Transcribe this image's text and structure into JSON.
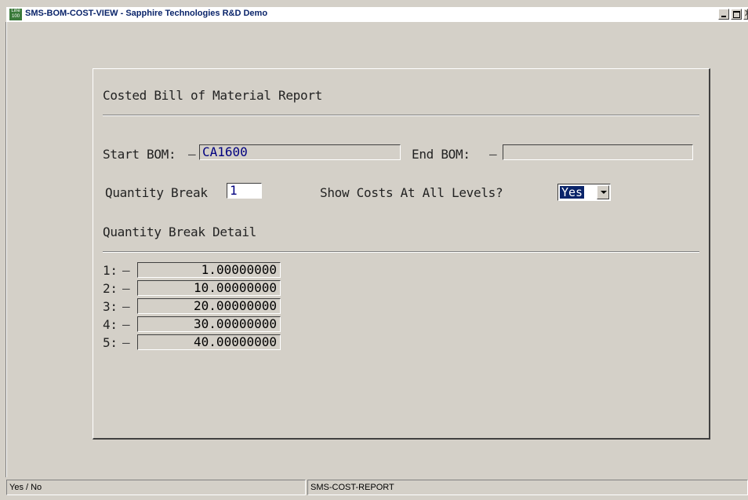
{
  "window": {
    "title": "SMS-BOM-COST-VIEW - Sapphire Technologies R&D Demo",
    "icon_text": "Line 100",
    "minimize_icon": "minimize-icon",
    "maximize_icon": "maximize-icon",
    "close_label": "X"
  },
  "report": {
    "heading": "Costed Bill of Material Report",
    "start_bom_label": "Start BOM:",
    "start_bom_value": "CA1600",
    "end_bom_label": "End BOM:",
    "end_bom_value": "",
    "dash": "–",
    "quantity_break_label": "Quantity Break",
    "quantity_break_value": "1",
    "show_costs_label": "Show Costs At All Levels?",
    "show_costs_value": "Yes",
    "detail_heading": "Quantity Break Detail",
    "breaks": [
      {
        "label": "1:",
        "value": "1.00000000"
      },
      {
        "label": "2:",
        "value": "10.00000000"
      },
      {
        "label": "3:",
        "value": "20.00000000"
      },
      {
        "label": "4:",
        "value": "30.00000000"
      },
      {
        "label": "5:",
        "value": "40.00000000"
      }
    ]
  },
  "status": {
    "hint": "Yes / No",
    "program": "SMS-COST-REPORT"
  }
}
